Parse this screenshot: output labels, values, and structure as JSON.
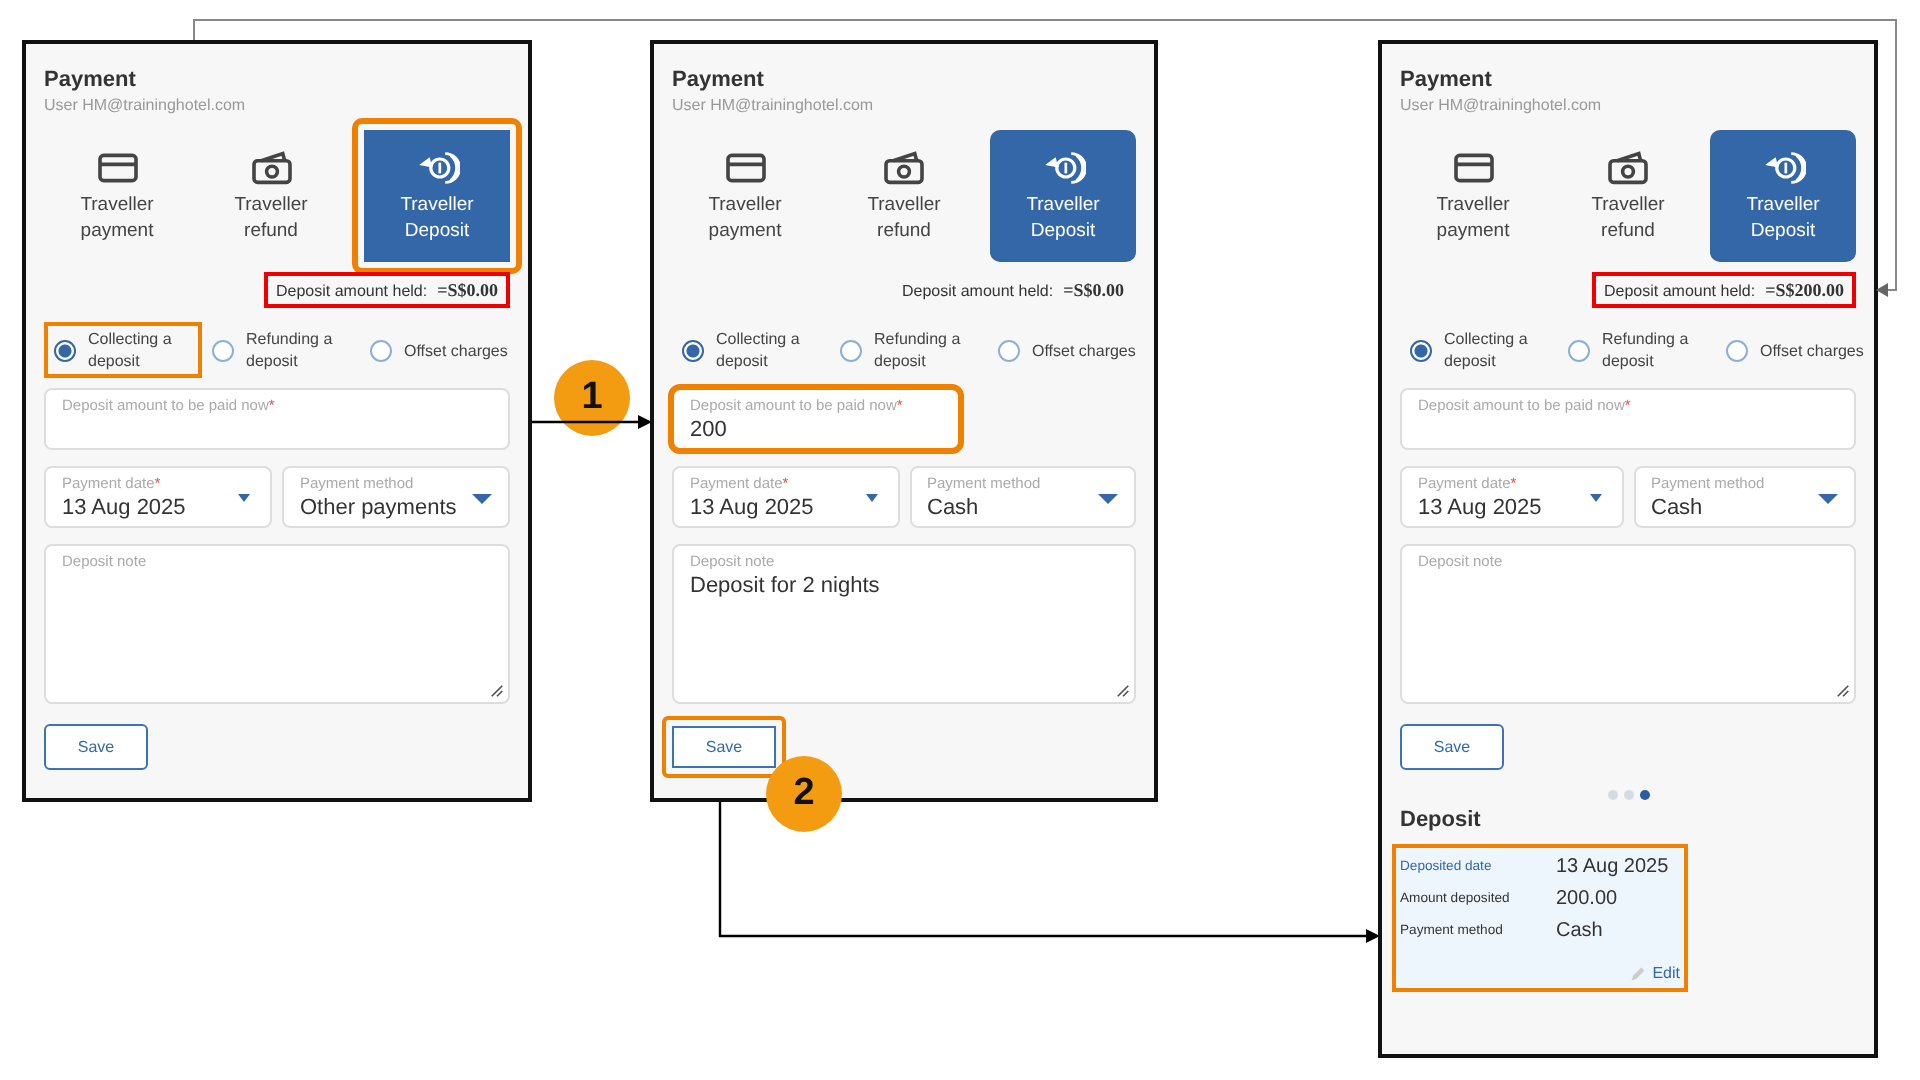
{
  "panels": [
    {
      "title": "Payment",
      "user": "User HM@traininghotel.com",
      "tabs": [
        {
          "kind": "card",
          "label": "Traveller payment",
          "selected": false,
          "highlighted": false
        },
        {
          "kind": "cash",
          "label": "Traveller refund",
          "selected": false,
          "highlighted": false
        },
        {
          "kind": "deposit",
          "label": "Traveller Deposit",
          "selected": true,
          "highlighted": true
        }
      ],
      "deposit_held": {
        "label": "Deposit amount held:",
        "value": "=S$0.00",
        "highlighted": true
      },
      "options": [
        {
          "label": "Collecting a deposit",
          "selected": true,
          "highlighted": true
        },
        {
          "label": "Refunding a deposit",
          "selected": false,
          "highlighted": false
        },
        {
          "label": "Offset charges",
          "selected": false,
          "highlighted": false
        }
      ],
      "amount_field": {
        "label": "Deposit amount to be paid now",
        "required_mark": "*",
        "highlighted": false
      },
      "date_field": {
        "label": "Payment date",
        "required_mark": "*",
        "value": "13 Aug 2025"
      },
      "method_field": {
        "label": "Payment method",
        "value": "Other payments"
      },
      "note_field": {
        "label": "Deposit note"
      },
      "save_button": {
        "label": "Save",
        "highlighted": false
      },
      "step_badge": "1"
    },
    {
      "title": "Payment",
      "user": "User HM@traininghotel.com",
      "tabs": [
        {
          "kind": "card",
          "label": "Traveller payment",
          "selected": false,
          "highlighted": false
        },
        {
          "kind": "cash",
          "label": "Traveller refund",
          "selected": false,
          "highlighted": false
        },
        {
          "kind": "deposit",
          "label": "Traveller Deposit",
          "selected": true,
          "highlighted": false
        }
      ],
      "deposit_held": {
        "label": "Deposit amount held:",
        "value": "=S$0.00",
        "highlighted": false
      },
      "options": [
        {
          "label": "Collecting a deposit",
          "selected": true,
          "highlighted": false
        },
        {
          "label": "Refunding a deposit",
          "selected": false,
          "highlighted": false
        },
        {
          "label": "Offset charges",
          "selected": false,
          "highlighted": false
        }
      ],
      "amount_field": {
        "label": "Deposit amount to be paid now",
        "required_mark": "*",
        "value": "200",
        "highlighted": true
      },
      "date_field": {
        "label": "Payment date",
        "required_mark": "*",
        "value": "13 Aug 2025"
      },
      "method_field": {
        "label": "Payment method",
        "value": "Cash"
      },
      "note_field": {
        "label": "Deposit note",
        "value": "Deposit for 2 nights"
      },
      "save_button": {
        "label": "Save",
        "highlighted": true
      },
      "step_badge": "2"
    },
    {
      "title": "Payment",
      "user": "User HM@traininghotel.com",
      "tabs": [
        {
          "kind": "card",
          "label": "Traveller payment",
          "selected": false,
          "highlighted": false
        },
        {
          "kind": "cash",
          "label": "Traveller refund",
          "selected": false,
          "highlighted": false
        },
        {
          "kind": "deposit",
          "label": "Traveller Deposit",
          "selected": true,
          "highlighted": false
        }
      ],
      "deposit_held": {
        "label": "Deposit amount held:",
        "value": "=S$200.00",
        "highlighted": true
      },
      "options": [
        {
          "label": "Collecting a deposit",
          "selected": true,
          "highlighted": false
        },
        {
          "label": "Refunding a deposit",
          "selected": false,
          "highlighted": false
        },
        {
          "label": "Offset charges",
          "selected": false,
          "highlighted": false
        }
      ],
      "amount_field": {
        "label": "Deposit amount to be paid now",
        "required_mark": "*",
        "highlighted": false
      },
      "date_field": {
        "label": "Payment date",
        "required_mark": "*",
        "value": "13 Aug 2025"
      },
      "method_field": {
        "label": "Payment method",
        "value": "Cash"
      },
      "note_field": {
        "label": "Deposit note"
      },
      "save_button": {
        "label": "Save",
        "highlighted": false
      },
      "carousel": [
        {
          "selected": false
        },
        {
          "selected": false
        },
        {
          "selected": true
        }
      ],
      "deposit_summary": {
        "title": "Deposit",
        "highlighted": true,
        "rows": [
          {
            "label": "Deposited date",
            "value": "13 Aug 2025"
          },
          {
            "label": "Amount deposited",
            "value": "200.00"
          },
          {
            "label": "Payment method",
            "value": "Cash"
          }
        ],
        "edit_link": "Edit"
      }
    }
  ]
}
